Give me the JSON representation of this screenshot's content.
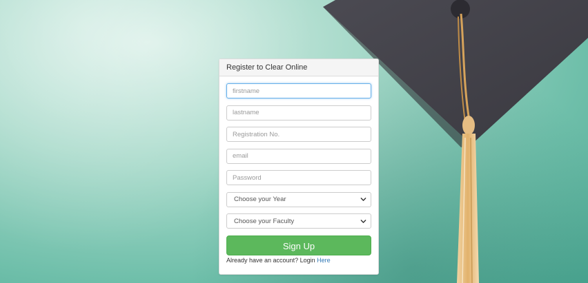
{
  "form": {
    "heading": "Register to Clear Online",
    "fields": {
      "firstname": {
        "placeholder": "firstname"
      },
      "lastname": {
        "placeholder": "lastname"
      },
      "registration": {
        "placeholder": "Registration No."
      },
      "email": {
        "placeholder": "email"
      },
      "password": {
        "placeholder": "Password"
      }
    },
    "year_select": {
      "selected": "Choose your Year"
    },
    "faculty_select": {
      "selected": "Choose your Faculty"
    },
    "submit_label": "Sign Up",
    "login_prompt": "Already have an account? Login",
    "login_link": "Here"
  },
  "colors": {
    "accent_green": "#5cb85c",
    "link_blue": "#337ab7",
    "focus_blue": "#66afe9",
    "background_teal": "#6fbfaa",
    "cap_gray": "#4a4a52",
    "tassel_gold": "#e9c48c"
  },
  "icons": {
    "select_arrow": "chevron-down-icon",
    "background": "graduation-cap-illustration"
  }
}
